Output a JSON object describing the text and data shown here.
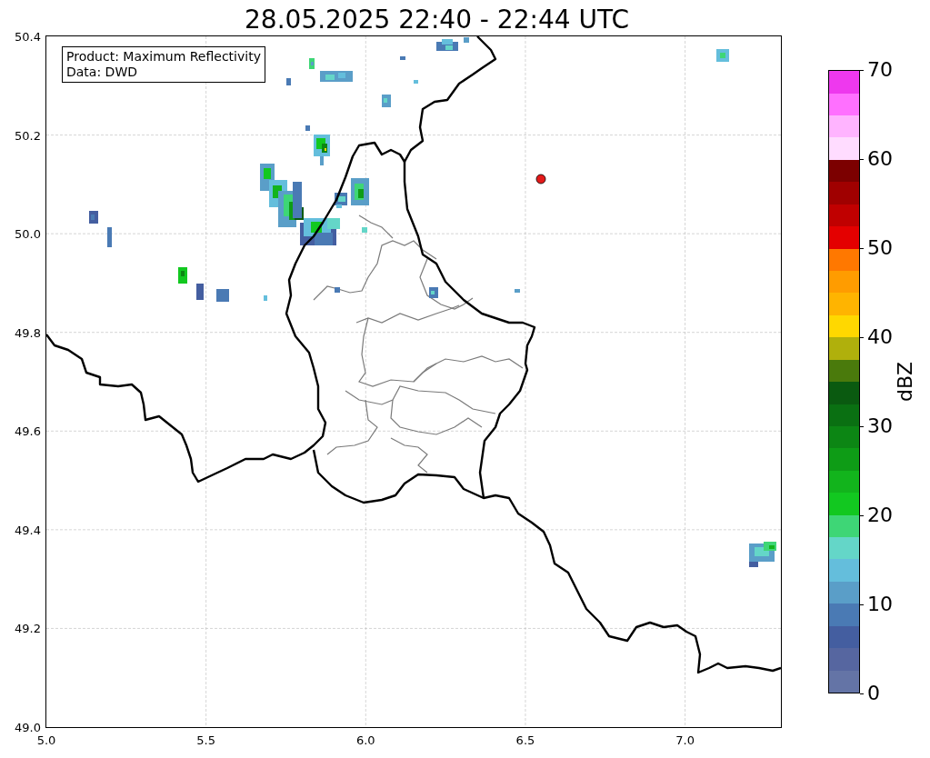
{
  "title": "28.05.2025 22:40 - 22:44 UTC",
  "map": {
    "legend": [
      "Product: Maximum Reflectivity",
      "Data: DWD"
    ],
    "xticks": [
      "5.0",
      "5.5",
      "6.0",
      "6.5",
      "7.0"
    ],
    "yticks": [
      "50.4",
      "50.2",
      "50.0",
      "49.8",
      "49.6",
      "49.4",
      "49.2",
      "49.0"
    ]
  },
  "colorbar": {
    "label": "dBZ",
    "ticks": [
      "70",
      "60",
      "50",
      "40",
      "30",
      "20",
      "10",
      "0"
    ],
    "bins": [
      {
        "color": "#6474a6"
      },
      {
        "color": "#5666a0"
      },
      {
        "color": "#445ea0"
      },
      {
        "color": "#4a7ab4"
      },
      {
        "color": "#5a9ec8"
      },
      {
        "color": "#64bedc"
      },
      {
        "color": "#64d6c8"
      },
      {
        "color": "#3ed676"
      },
      {
        "color": "#12c820"
      },
      {
        "color": "#12b41c"
      },
      {
        "color": "#0e9c16"
      },
      {
        "color": "#0c8614"
      },
      {
        "color": "#0a7012"
      },
      {
        "color": "#0a5a10"
      },
      {
        "color": "#4a7a0c"
      },
      {
        "color": "#b0b00c"
      },
      {
        "color": "#ffd800"
      },
      {
        "color": "#ffb400"
      },
      {
        "color": "#ff9c00"
      },
      {
        "color": "#ff7800"
      },
      {
        "color": "#e40000"
      },
      {
        "color": "#c00000"
      },
      {
        "color": "#a00000"
      },
      {
        "color": "#7c0000"
      },
      {
        "color": "#ffdcff"
      },
      {
        "color": "#ffb4ff"
      },
      {
        "color": "#ff70ff"
      },
      {
        "color": "#ee38ee"
      }
    ]
  }
}
